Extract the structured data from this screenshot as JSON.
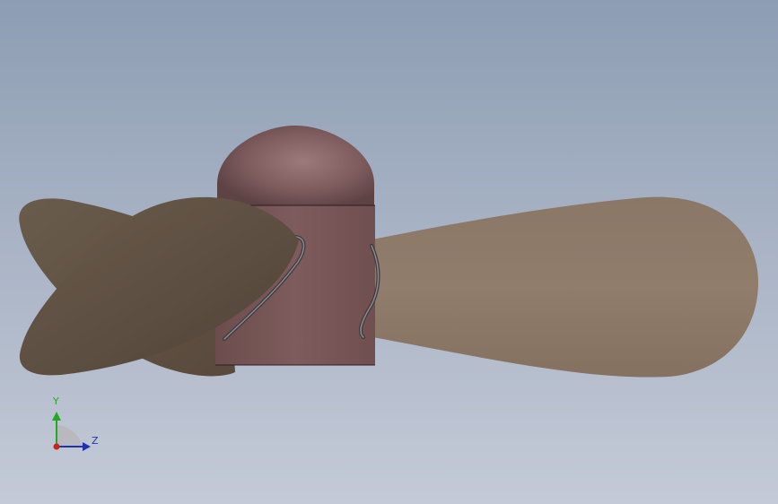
{
  "triad": {
    "y_label": "Y",
    "z_label": "Z"
  },
  "colors": {
    "background_top": "#8d9db3",
    "background_bottom": "#c4cad7",
    "hub_color": "#7a5858",
    "cap_color": "#8a6668",
    "blade_dark": "#5e5244",
    "blade_light": "#8d7a68",
    "axis_y": "#22a822",
    "axis_z": "#2233aa",
    "axis_x": "#cc2222"
  }
}
